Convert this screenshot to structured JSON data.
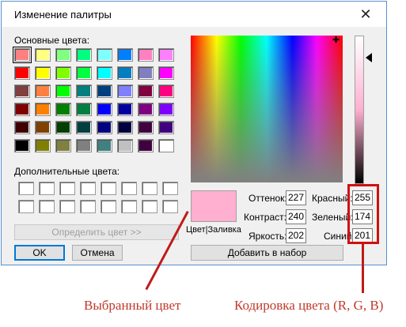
{
  "window": {
    "title": "Изменение палитры",
    "close_glyph": "✕"
  },
  "basic_colors": {
    "label": "Основные цвета:",
    "swatches": [
      "#ff8080",
      "#ffff80",
      "#80ff80",
      "#00ff80",
      "#80ffff",
      "#0080ff",
      "#ff80c0",
      "#ff80ff",
      "#ff0000",
      "#ffff00",
      "#80ff00",
      "#00ff40",
      "#00ffff",
      "#0080c0",
      "#8080c0",
      "#ff00ff",
      "#804040",
      "#ff8040",
      "#00ff00",
      "#008080",
      "#004080",
      "#8080ff",
      "#800040",
      "#ff0080",
      "#800000",
      "#ff8000",
      "#008000",
      "#008040",
      "#0000ff",
      "#0000a0",
      "#800080",
      "#8000ff",
      "#400000",
      "#804000",
      "#004000",
      "#004040",
      "#000080",
      "#000040",
      "#400040",
      "#400080",
      "#000000",
      "#808000",
      "#808040",
      "#808080",
      "#408080",
      "#c0c0c0",
      "#400040",
      "#ffffff"
    ],
    "selected_index": 0
  },
  "custom_colors": {
    "label": "Дополнительные цвета:",
    "count": 16
  },
  "buttons": {
    "define": "Определить цвет >>",
    "ok": "OK",
    "cancel": "Отмена",
    "add": "Добавить в набор"
  },
  "preview": {
    "label": "Цвет|Заливка",
    "color": "#ffafd0"
  },
  "hsl": {
    "hue_label": "Оттенок:",
    "hue": "227",
    "sat_label": "Контраст:",
    "sat": "240",
    "lum_label": "Яркость:",
    "lum": "202"
  },
  "rgb": {
    "red_label": "Красный:",
    "red": "255",
    "green_label": "Зеленый:",
    "green": "174",
    "blue_label": "Синий:",
    "blue": "201"
  },
  "annotations": {
    "selected_color": "Выбранный цвет",
    "color_code": "Кодировка цвета (R, G, B)"
  },
  "colors": {
    "accent": "#0078d7",
    "annotation": "#c0392b"
  }
}
